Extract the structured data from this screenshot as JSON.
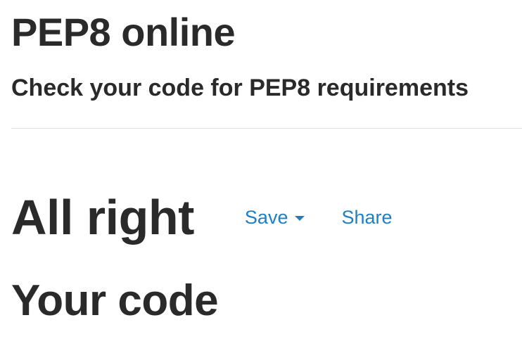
{
  "header": {
    "title": "PEP8 online",
    "subtitle": "Check your code for PEP8 requirements"
  },
  "result": {
    "heading": "All right",
    "save_label": "Save",
    "share_label": "Share",
    "caret_icon": "caret-down-icon",
    "link_color": "#1f7fc4"
  },
  "code_section": {
    "heading": "Your code"
  }
}
